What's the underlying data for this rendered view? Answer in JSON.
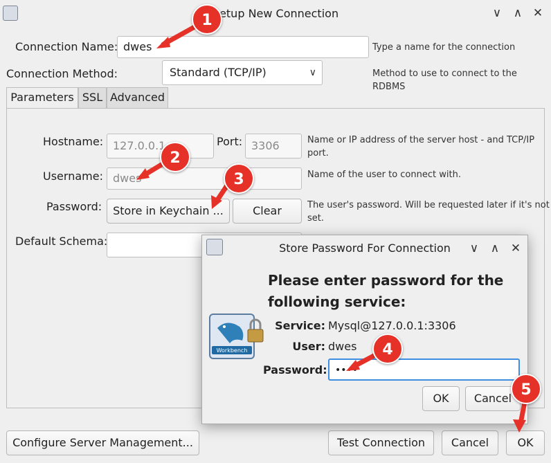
{
  "window": {
    "title": "Setup New Connection",
    "controls": [
      "∨",
      "∧",
      "✕"
    ]
  },
  "form": {
    "connection_name_label": "Connection Name:",
    "connection_name_value": "dwes",
    "connection_name_hint": "Type a name for the connection",
    "method_label": "Connection Method:",
    "method_value": "Standard (TCP/IP)",
    "method_hint": "Method to use to connect to the RDBMS"
  },
  "tabs": [
    "Parameters",
    "SSL",
    "Advanced"
  ],
  "parameters": {
    "hostname_label": "Hostname:",
    "hostname_value": "127.0.0.1",
    "port_label": "Port:",
    "port_value": "3306",
    "host_hint_1": "Name or IP address of the server host - and TCP/IP",
    "host_hint_2": "port.",
    "username_label": "Username:",
    "username_value": "dwes",
    "username_hint": "Name of the user to connect with.",
    "password_label": "Password:",
    "store_button": "Store in Keychain ...",
    "clear_button": "Clear",
    "password_hint_1": "The user's password. Will be requested later if it's not",
    "password_hint_2": "set.",
    "schema_label": "Default Schema:",
    "schema_value": ""
  },
  "footer": {
    "configure_button": "Configure Server Management...",
    "test_button": "Test Connection",
    "cancel_button": "Cancel",
    "ok_button": "OK"
  },
  "modal": {
    "title": "Store Password For Connection",
    "controls": [
      "∨",
      "∧",
      "✕"
    ],
    "heading_line1": "Please enter password for the",
    "heading_line2": "following service:",
    "service_label": "Service:",
    "service_value": "Mysql@127.0.0.1:3306",
    "user_label": "User:",
    "user_value": "dwes",
    "password_label": "Password:",
    "password_value": "••••",
    "ok_button": "OK",
    "cancel_button": "Cancel",
    "logo_text": "Workbench"
  },
  "annotations": [
    "1",
    "2",
    "3",
    "4",
    "5"
  ],
  "colors": {
    "badge": "#e53127",
    "focus": "#3d8ee0"
  }
}
